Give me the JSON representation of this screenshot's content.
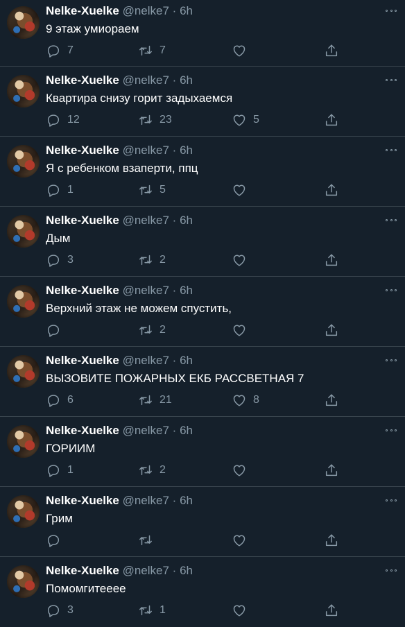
{
  "tweets": [
    {
      "name": "Nelke-Xuelke",
      "handle": "@nelke7",
      "time": "6h",
      "text": "9 этаж умиораем",
      "replies": "7",
      "retweets": "7",
      "likes": ""
    },
    {
      "name": "Nelke-Xuelke",
      "handle": "@nelke7",
      "time": "6h",
      "text": "Квартира снизу горит задыхаемся",
      "replies": "12",
      "retweets": "23",
      "likes": "5"
    },
    {
      "name": "Nelke-Xuelke",
      "handle": "@nelke7",
      "time": "6h",
      "text": "Я с ребенком взаперти, ппц",
      "replies": "1",
      "retweets": "5",
      "likes": ""
    },
    {
      "name": "Nelke-Xuelke",
      "handle": "@nelke7",
      "time": "6h",
      "text": "Дым",
      "replies": "3",
      "retweets": "2",
      "likes": ""
    },
    {
      "name": "Nelke-Xuelke",
      "handle": "@nelke7",
      "time": "6h",
      "text": "Верхний этаж не можем спустить,",
      "replies": "",
      "retweets": "2",
      "likes": ""
    },
    {
      "name": "Nelke-Xuelke",
      "handle": "@nelke7",
      "time": "6h",
      "text": "ВЫЗОВИТЕ ПОЖАРНЫХ ЕКБ РАССВЕТНАЯ 7",
      "replies": "6",
      "retweets": "21",
      "likes": "8"
    },
    {
      "name": "Nelke-Xuelke",
      "handle": "@nelke7",
      "time": "6h",
      "text": "ГОРИИМ",
      "replies": "1",
      "retweets": "2",
      "likes": ""
    },
    {
      "name": "Nelke-Xuelke",
      "handle": "@nelke7",
      "time": "6h",
      "text": "Грим",
      "replies": "",
      "retweets": "",
      "likes": ""
    },
    {
      "name": "Nelke-Xuelke",
      "handle": "@nelke7",
      "time": "6h",
      "text": "Помомгитееее",
      "replies": "3",
      "retweets": "1",
      "likes": ""
    }
  ],
  "separator": "·",
  "icons": {
    "avatar": "profile-photo",
    "more": "more-options-icon",
    "reply": "reply-icon",
    "retweet": "retweet-icon",
    "like": "like-icon",
    "share": "share-icon"
  },
  "colors": {
    "background": "#15202b",
    "divider": "#38444d",
    "text": "#ffffff",
    "secondary": "#8899a6"
  }
}
